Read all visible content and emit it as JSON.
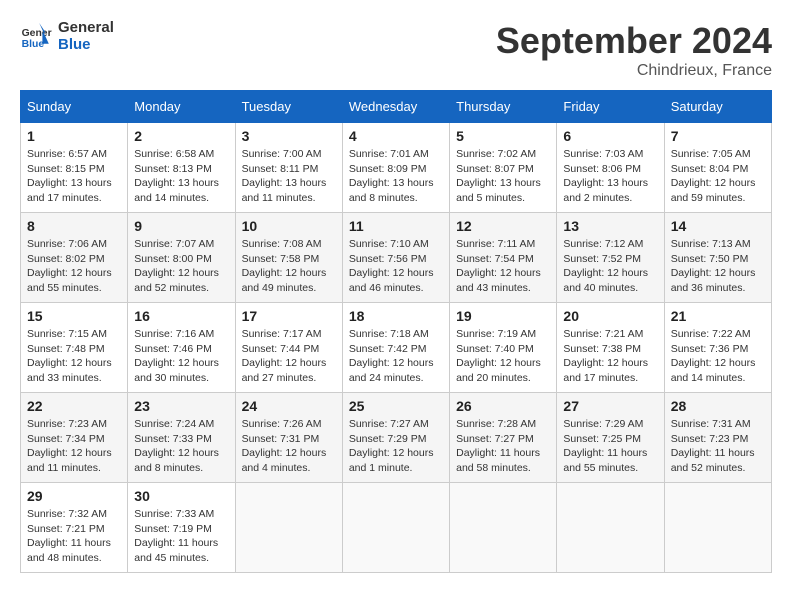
{
  "header": {
    "logo_text_general": "General",
    "logo_text_blue": "Blue",
    "month_title": "September 2024",
    "location": "Chindrieux, France"
  },
  "calendar": {
    "days_of_week": [
      "Sunday",
      "Monday",
      "Tuesday",
      "Wednesday",
      "Thursday",
      "Friday",
      "Saturday"
    ],
    "weeks": [
      [
        {
          "day": "",
          "sunrise": "",
          "sunset": "",
          "daylight": ""
        },
        {
          "day": "2",
          "sunrise": "Sunrise: 6:58 AM",
          "sunset": "Sunset: 8:13 PM",
          "daylight": "Daylight: 13 hours and 14 minutes."
        },
        {
          "day": "3",
          "sunrise": "Sunrise: 7:00 AM",
          "sunset": "Sunset: 8:11 PM",
          "daylight": "Daylight: 13 hours and 11 minutes."
        },
        {
          "day": "4",
          "sunrise": "Sunrise: 7:01 AM",
          "sunset": "Sunset: 8:09 PM",
          "daylight": "Daylight: 13 hours and 8 minutes."
        },
        {
          "day": "5",
          "sunrise": "Sunrise: 7:02 AM",
          "sunset": "Sunset: 8:07 PM",
          "daylight": "Daylight: 13 hours and 5 minutes."
        },
        {
          "day": "6",
          "sunrise": "Sunrise: 7:03 AM",
          "sunset": "Sunset: 8:06 PM",
          "daylight": "Daylight: 13 hours and 2 minutes."
        },
        {
          "day": "7",
          "sunrise": "Sunrise: 7:05 AM",
          "sunset": "Sunset: 8:04 PM",
          "daylight": "Daylight: 12 hours and 59 minutes."
        }
      ],
      [
        {
          "day": "8",
          "sunrise": "Sunrise: 7:06 AM",
          "sunset": "Sunset: 8:02 PM",
          "daylight": "Daylight: 12 hours and 55 minutes."
        },
        {
          "day": "9",
          "sunrise": "Sunrise: 7:07 AM",
          "sunset": "Sunset: 8:00 PM",
          "daylight": "Daylight: 12 hours and 52 minutes."
        },
        {
          "day": "10",
          "sunrise": "Sunrise: 7:08 AM",
          "sunset": "Sunset: 7:58 PM",
          "daylight": "Daylight: 12 hours and 49 minutes."
        },
        {
          "day": "11",
          "sunrise": "Sunrise: 7:10 AM",
          "sunset": "Sunset: 7:56 PM",
          "daylight": "Daylight: 12 hours and 46 minutes."
        },
        {
          "day": "12",
          "sunrise": "Sunrise: 7:11 AM",
          "sunset": "Sunset: 7:54 PM",
          "daylight": "Daylight: 12 hours and 43 minutes."
        },
        {
          "day": "13",
          "sunrise": "Sunrise: 7:12 AM",
          "sunset": "Sunset: 7:52 PM",
          "daylight": "Daylight: 12 hours and 40 minutes."
        },
        {
          "day": "14",
          "sunrise": "Sunrise: 7:13 AM",
          "sunset": "Sunset: 7:50 PM",
          "daylight": "Daylight: 12 hours and 36 minutes."
        }
      ],
      [
        {
          "day": "15",
          "sunrise": "Sunrise: 7:15 AM",
          "sunset": "Sunset: 7:48 PM",
          "daylight": "Daylight: 12 hours and 33 minutes."
        },
        {
          "day": "16",
          "sunrise": "Sunrise: 7:16 AM",
          "sunset": "Sunset: 7:46 PM",
          "daylight": "Daylight: 12 hours and 30 minutes."
        },
        {
          "day": "17",
          "sunrise": "Sunrise: 7:17 AM",
          "sunset": "Sunset: 7:44 PM",
          "daylight": "Daylight: 12 hours and 27 minutes."
        },
        {
          "day": "18",
          "sunrise": "Sunrise: 7:18 AM",
          "sunset": "Sunset: 7:42 PM",
          "daylight": "Daylight: 12 hours and 24 minutes."
        },
        {
          "day": "19",
          "sunrise": "Sunrise: 7:19 AM",
          "sunset": "Sunset: 7:40 PM",
          "daylight": "Daylight: 12 hours and 20 minutes."
        },
        {
          "day": "20",
          "sunrise": "Sunrise: 7:21 AM",
          "sunset": "Sunset: 7:38 PM",
          "daylight": "Daylight: 12 hours and 17 minutes."
        },
        {
          "day": "21",
          "sunrise": "Sunrise: 7:22 AM",
          "sunset": "Sunset: 7:36 PM",
          "daylight": "Daylight: 12 hours and 14 minutes."
        }
      ],
      [
        {
          "day": "22",
          "sunrise": "Sunrise: 7:23 AM",
          "sunset": "Sunset: 7:34 PM",
          "daylight": "Daylight: 12 hours and 11 minutes."
        },
        {
          "day": "23",
          "sunrise": "Sunrise: 7:24 AM",
          "sunset": "Sunset: 7:33 PM",
          "daylight": "Daylight: 12 hours and 8 minutes."
        },
        {
          "day": "24",
          "sunrise": "Sunrise: 7:26 AM",
          "sunset": "Sunset: 7:31 PM",
          "daylight": "Daylight: 12 hours and 4 minutes."
        },
        {
          "day": "25",
          "sunrise": "Sunrise: 7:27 AM",
          "sunset": "Sunset: 7:29 PM",
          "daylight": "Daylight: 12 hours and 1 minute."
        },
        {
          "day": "26",
          "sunrise": "Sunrise: 7:28 AM",
          "sunset": "Sunset: 7:27 PM",
          "daylight": "Daylight: 11 hours and 58 minutes."
        },
        {
          "day": "27",
          "sunrise": "Sunrise: 7:29 AM",
          "sunset": "Sunset: 7:25 PM",
          "daylight": "Daylight: 11 hours and 55 minutes."
        },
        {
          "day": "28",
          "sunrise": "Sunrise: 7:31 AM",
          "sunset": "Sunset: 7:23 PM",
          "daylight": "Daylight: 11 hours and 52 minutes."
        }
      ],
      [
        {
          "day": "29",
          "sunrise": "Sunrise: 7:32 AM",
          "sunset": "Sunset: 7:21 PM",
          "daylight": "Daylight: 11 hours and 48 minutes."
        },
        {
          "day": "30",
          "sunrise": "Sunrise: 7:33 AM",
          "sunset": "Sunset: 7:19 PM",
          "daylight": "Daylight: 11 hours and 45 minutes."
        },
        {
          "day": "",
          "sunrise": "",
          "sunset": "",
          "daylight": ""
        },
        {
          "day": "",
          "sunrise": "",
          "sunset": "",
          "daylight": ""
        },
        {
          "day": "",
          "sunrise": "",
          "sunset": "",
          "daylight": ""
        },
        {
          "day": "",
          "sunrise": "",
          "sunset": "",
          "daylight": ""
        },
        {
          "day": "",
          "sunrise": "",
          "sunset": "",
          "daylight": ""
        }
      ]
    ],
    "week0_day1": {
      "day": "1",
      "sunrise": "Sunrise: 6:57 AM",
      "sunset": "Sunset: 8:15 PM",
      "daylight": "Daylight: 13 hours and 17 minutes."
    }
  }
}
